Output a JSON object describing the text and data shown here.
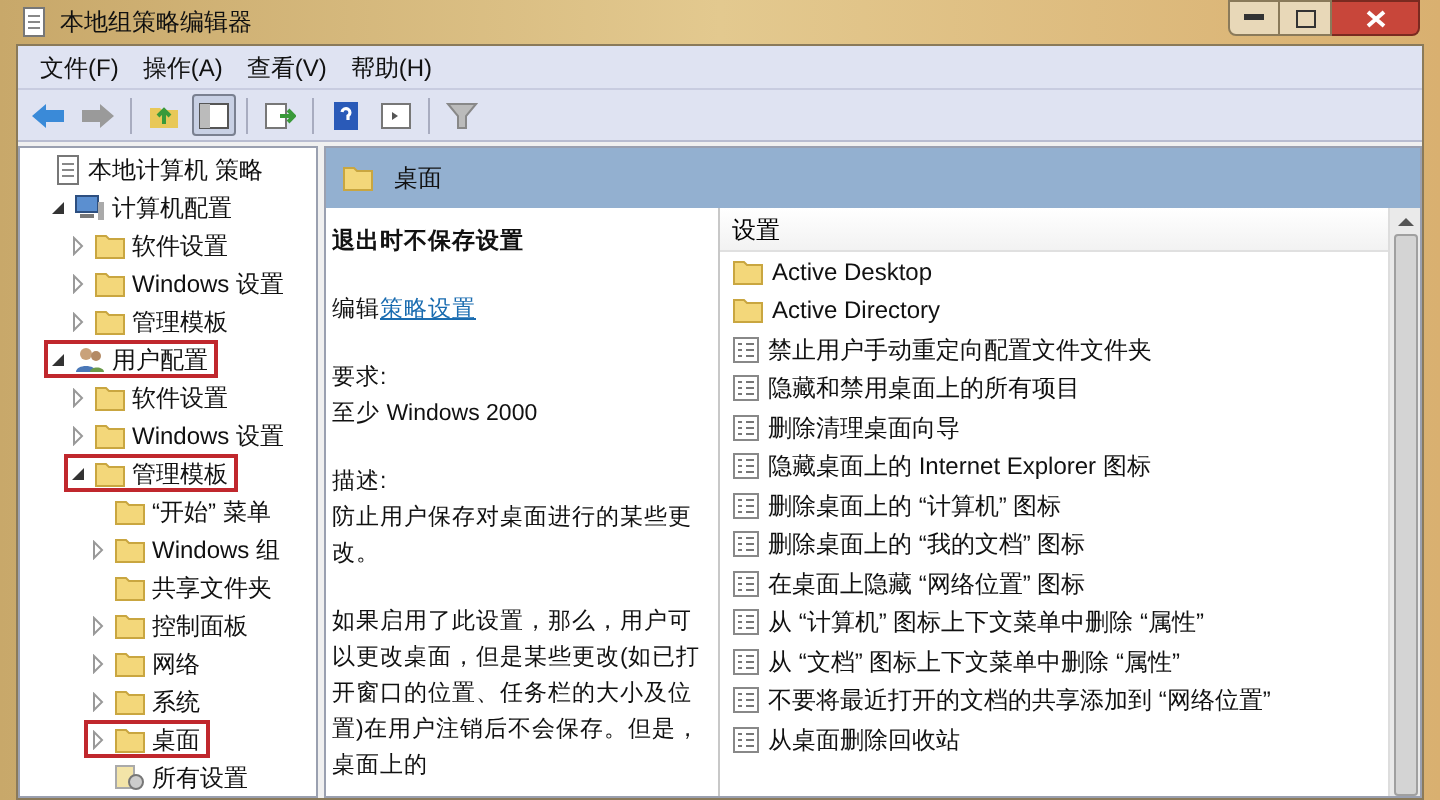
{
  "window": {
    "title": "本地组策略编辑器"
  },
  "menu": [
    "文件(F)",
    "操作(A)",
    "查看(V)",
    "帮助(H)"
  ],
  "toolbar": [
    {
      "kind": "back",
      "pressed": false
    },
    {
      "kind": "forward",
      "pressed": false
    },
    {
      "kind": "up",
      "pressed": false
    },
    {
      "kind": "tree",
      "pressed": true
    },
    {
      "kind": "export",
      "pressed": false
    },
    {
      "kind": "help",
      "pressed": false
    },
    {
      "kind": "pane",
      "pressed": false
    },
    {
      "kind": "filter",
      "pressed": false
    }
  ],
  "tree": [
    {
      "label": "本地计算机 策略",
      "kind": "policy",
      "marked": false,
      "children": [
        {
          "label": "计算机配置",
          "kind": "computer",
          "expanded": true,
          "marked": false,
          "children": [
            {
              "label": "软件设置",
              "kind": "folder",
              "expanded": false,
              "marked": false
            },
            {
              "label": "Windows 设置",
              "kind": "folder",
              "expanded": false,
              "marked": false
            },
            {
              "label": "管理模板",
              "kind": "folder",
              "expanded": false,
              "marked": false
            }
          ]
        },
        {
          "label": "用户配置",
          "kind": "user",
          "expanded": true,
          "marked": true,
          "children": [
            {
              "label": "软件设置",
              "kind": "folder",
              "expanded": false,
              "marked": false
            },
            {
              "label": "Windows 设置",
              "kind": "folder",
              "expanded": false,
              "marked": false
            },
            {
              "label": "管理模板",
              "kind": "folder",
              "expanded": true,
              "marked": true,
              "children": [
                {
                  "label": "“开始” 菜单",
                  "kind": "folder",
                  "marked": false
                },
                {
                  "label": "Windows 组",
                  "kind": "folder",
                  "expanded": false,
                  "marked": false
                },
                {
                  "label": "共享文件夹",
                  "kind": "folder",
                  "marked": false
                },
                {
                  "label": "控制面板",
                  "kind": "folder",
                  "expanded": false,
                  "marked": false
                },
                {
                  "label": "网络",
                  "kind": "folder",
                  "expanded": false,
                  "marked": false
                },
                {
                  "label": "系统",
                  "kind": "folder",
                  "expanded": false,
                  "marked": false
                },
                {
                  "label": "桌面",
                  "kind": "folder",
                  "expanded": false,
                  "marked": true
                },
                {
                  "label": "所有设置",
                  "kind": "settings",
                  "marked": false
                }
              ]
            }
          ]
        }
      ]
    }
  ],
  "detail": {
    "header": "桌面",
    "title": "退出时不保存设置",
    "edit_prefix": "编辑",
    "edit_link": "策略设置",
    "requirement_label": "要求:",
    "requirement": "至少 Windows 2000",
    "description_label": "描述:",
    "description": [
      "防止用户保存对桌面进行的某些更改。",
      "如果启用了此设置，那么，用户可以更改桌面，但是某些更改(如已打开窗口的位置、任务栏的大小及位置)在用户注销后不会保存。但是，桌面上的"
    ]
  },
  "settings": {
    "column": "设置",
    "items": [
      {
        "label": "Active Desktop",
        "kind": "folder"
      },
      {
        "label": "Active Directory",
        "kind": "folder"
      },
      {
        "label": "禁止用户手动重定向配置文件文件夹",
        "kind": "setting"
      },
      {
        "label": "隐藏和禁用桌面上的所有项目",
        "kind": "setting"
      },
      {
        "label": "删除清理桌面向导",
        "kind": "setting"
      },
      {
        "label": "隐藏桌面上的 Internet Explorer 图标",
        "kind": "setting"
      },
      {
        "label": "删除桌面上的 “计算机” 图标",
        "kind": "setting"
      },
      {
        "label": "删除桌面上的 “我的文档” 图标",
        "kind": "setting"
      },
      {
        "label": "在桌面上隐藏 “网络位置” 图标",
        "kind": "setting"
      },
      {
        "label": "从 “计算机” 图标上下文菜单中删除 “属性”",
        "kind": "setting"
      },
      {
        "label": "从 “文档” 图标上下文菜单中删除 “属性”",
        "kind": "setting"
      },
      {
        "label": "不要将最近打开的文档的共享添加到 “网络位置”",
        "kind": "setting"
      },
      {
        "label": "从桌面删除回收站",
        "kind": "setting"
      }
    ]
  }
}
